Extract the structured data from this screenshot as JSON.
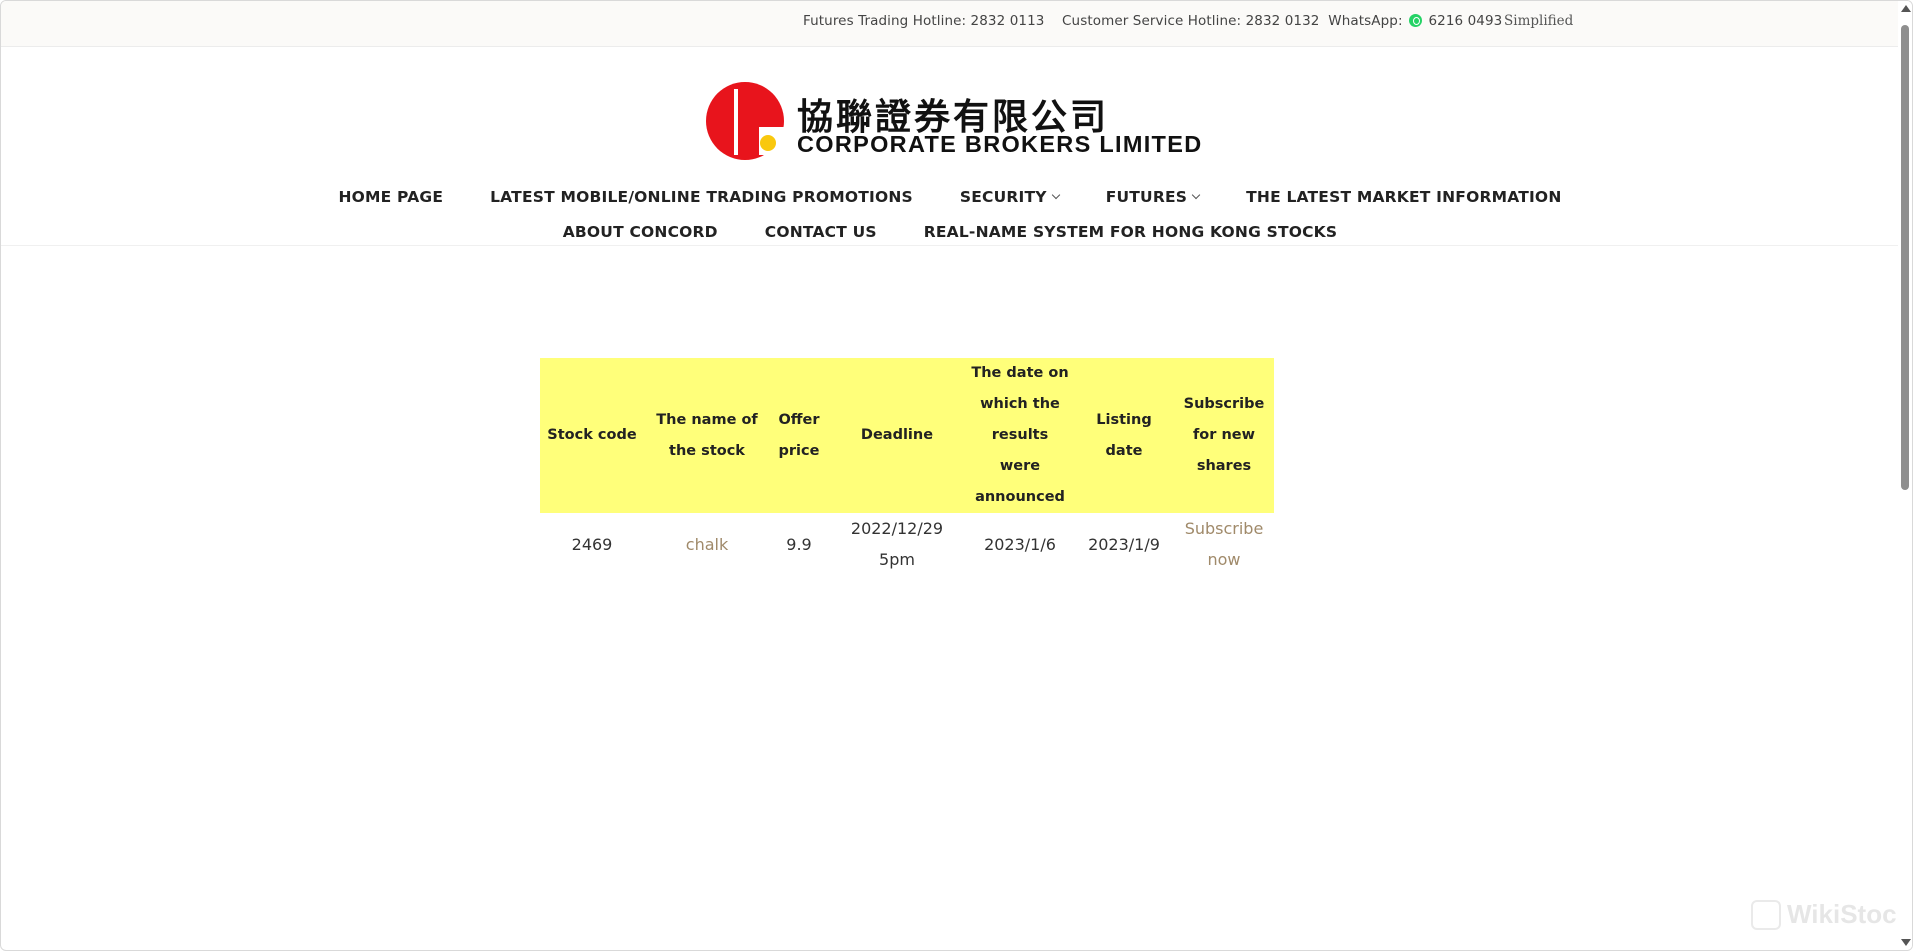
{
  "topbar": {
    "futures_hotline": "Futures Trading Hotline: 2832 0113",
    "customer_hotline": "Customer Service Hotline: 2832 0132",
    "whatsapp_label": "WhatsApp:",
    "whatsapp_number": "6216 0493",
    "language": "Simplified"
  },
  "logo": {
    "chinese_name": "協聯證券有限公司",
    "english_name": "CORPORATE BROKERS LIMITED",
    "colors": {
      "red": "#e8141c",
      "yellow": "#f9c80e"
    }
  },
  "nav": {
    "row1": [
      {
        "label": "HOME PAGE",
        "dropdown": false
      },
      {
        "label": "LATEST MOBILE/ONLINE TRADING PROMOTIONS",
        "dropdown": false
      },
      {
        "label": "SECURITY",
        "dropdown": true
      },
      {
        "label": "FUTURES",
        "dropdown": true
      },
      {
        "label": "THE LATEST MARKET INFORMATION",
        "dropdown": false
      }
    ],
    "row2": [
      {
        "label": "ABOUT CONCORD",
        "dropdown": false
      },
      {
        "label": "CONTACT US",
        "dropdown": false
      },
      {
        "label": "REAL-NAME SYSTEM FOR HONG KONG STOCKS",
        "dropdown": false
      }
    ]
  },
  "ipo_table": {
    "header_color": "#ffff7a",
    "columns": [
      "Stock code",
      "The name of the stock",
      "Offer price",
      "Deadline",
      "The date on which the results were announced",
      "Listing date",
      "Subscribe for new shares"
    ],
    "rows": [
      {
        "stock_code": "2469",
        "stock_name": "chalk",
        "offer_price": "9.9",
        "deadline": "2022/12/29 5pm",
        "results_date": "2023/1/6",
        "listing_date": "2023/1/9",
        "subscribe": "Subscribe now"
      }
    ]
  },
  "watermark": {
    "text": "WikiStock"
  }
}
